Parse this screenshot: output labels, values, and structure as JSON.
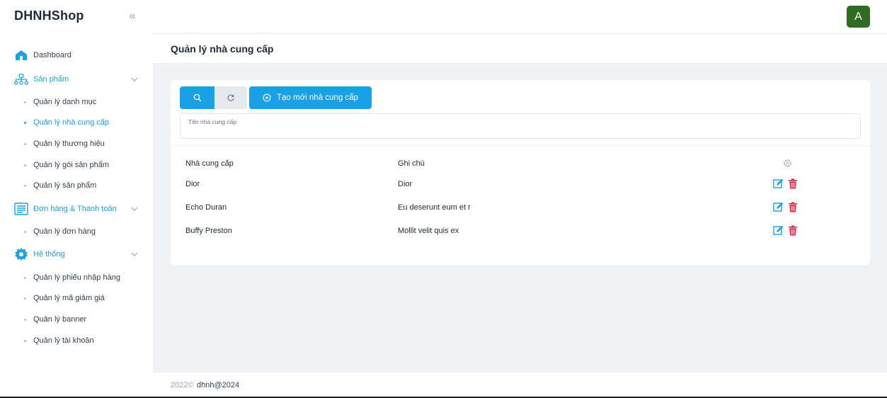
{
  "app": {
    "brand": "DHNHShop",
    "avatar_letter": "A",
    "accent": "#1aa0e6"
  },
  "sidebar": {
    "dashboard": "Dashboard",
    "groups": {
      "products": {
        "label": "Sản phẩm",
        "items": [
          "Quản lý danh mục",
          "Quản lý nhà cung cấp",
          "Quản lý thương hiệu",
          "Quản lý gói sản phẩm",
          "Quản lý sản phẩm"
        ]
      },
      "orders": {
        "label": "Đơn hàng & Thanh toán",
        "items": [
          "Quản lý đơn hàng"
        ]
      },
      "system": {
        "label": "Hệ thống",
        "items": [
          "Quản lý phiếu nhập hàng",
          "Quản lý mã giảm giá",
          "Quản lý banner",
          "Quản lý tài khoản"
        ]
      }
    }
  },
  "page": {
    "title": "Quản lý nhà cung cấp"
  },
  "toolbar": {
    "create_label": "Tạo mới nhà cung cấp"
  },
  "search": {
    "placeholder": "Tên nhà cung cấp"
  },
  "table": {
    "headers": [
      "Nhà cung cấp",
      "Ghi chú"
    ],
    "rows": [
      [
        "Dior",
        "Dior"
      ],
      [
        "Echo Duran",
        "Eu deserunt eum et r"
      ],
      [
        "Buffy Preston",
        "Mollit velit quis ex"
      ]
    ]
  },
  "footer": {
    "copyright": "2022©",
    "author": "dhnh@2024"
  }
}
